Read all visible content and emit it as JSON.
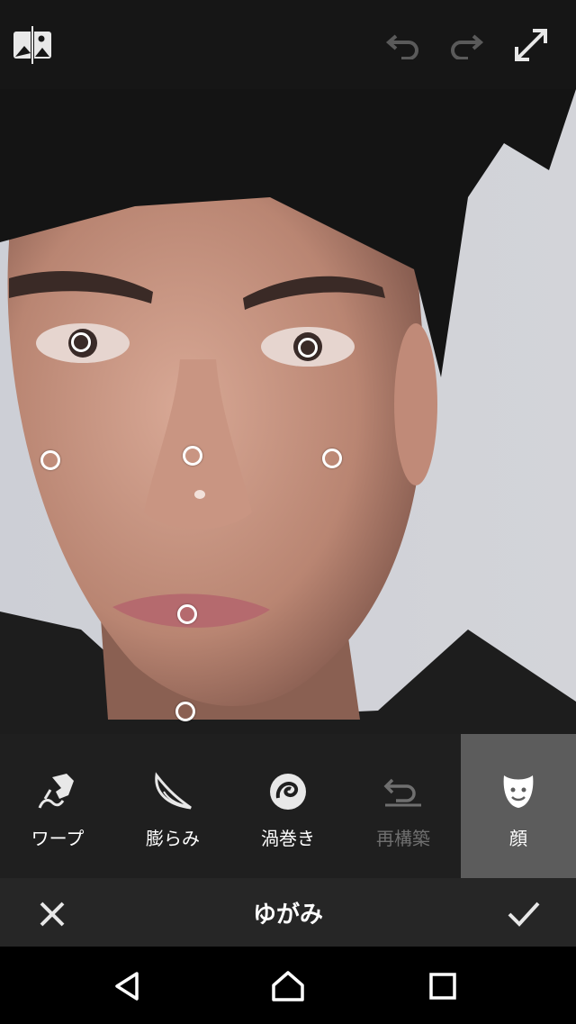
{
  "topbar": {
    "compare_icon": "compare-image-icon",
    "undo_icon": "undo-icon",
    "redo_icon": "redo-icon",
    "expand_icon": "fullscreen-icon"
  },
  "tools": [
    {
      "label": "ワープ",
      "icon": "warp-icon"
    },
    {
      "label": "膨らみ",
      "icon": "bulge-icon"
    },
    {
      "label": "渦巻き",
      "icon": "swirl-icon"
    },
    {
      "label": "再構築",
      "icon": "reconstruct-icon"
    },
    {
      "label": "顔",
      "icon": "face-icon"
    }
  ],
  "actionbar": {
    "title": "ゆがみ",
    "cancel_icon": "close-icon",
    "confirm_icon": "check-icon"
  },
  "navbar": {
    "back_icon": "back-icon",
    "home_icon": "home-icon",
    "recents_icon": "recents-icon"
  },
  "colors": {
    "toolbar": "#1f1f1f",
    "active_tool": "#5c5c5c",
    "disabled_text": "#6f6f6f"
  }
}
